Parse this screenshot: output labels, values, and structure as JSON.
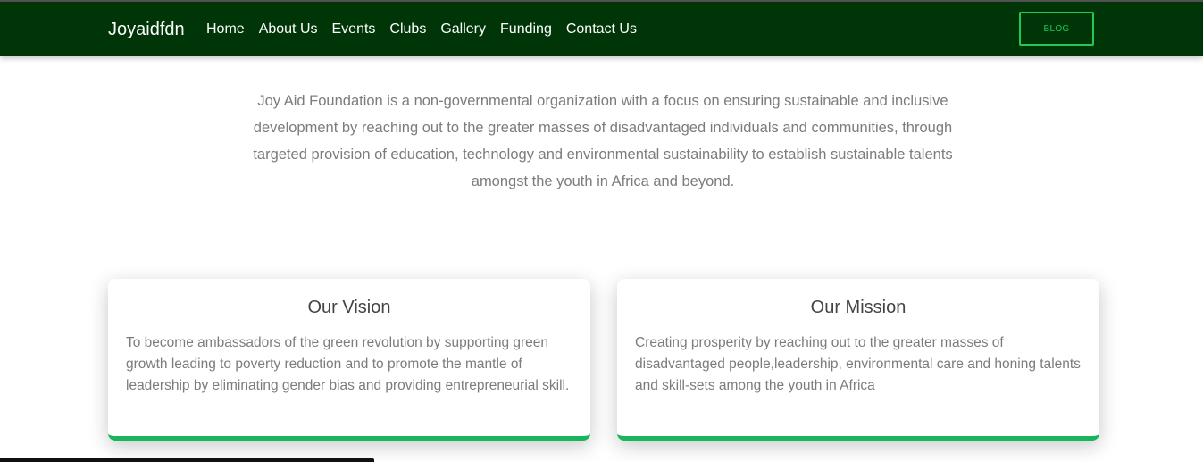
{
  "navbar": {
    "brand": "Joyaidfdn",
    "links": [
      {
        "label": "Home"
      },
      {
        "label": "About Us"
      },
      {
        "label": "Events"
      },
      {
        "label": "Clubs"
      },
      {
        "label": "Gallery"
      },
      {
        "label": "Funding"
      },
      {
        "label": "Contact Us"
      }
    ],
    "blog_label": "BLOG"
  },
  "intro": {
    "text": "Joy Aid Foundation is a non-governmental organization with a focus on ensuring sustainable and inclusive development by reaching out to the greater masses of disadvantaged individuals and communities, through targeted provision of education, technology and environmental sustainability to establish sustainable talents amongst the youth in Africa and beyond."
  },
  "cards": {
    "vision": {
      "title": "Our Vision",
      "text": "To become ambassadors of the green revolution by supporting green growth leading to poverty reduction and to promote the mantle of leadership by eliminating gender bias and providing entrepreneurial skill."
    },
    "mission": {
      "title": "Our Mission",
      "text": "Creating prosperity by reaching out to the greater masses of disadvantaged people,leadership, environmental care and honing talents and skill-sets among the youth in Africa"
    }
  },
  "colors": {
    "navbar_bg": "#003508",
    "accent_green": "#1ec95a",
    "card_border": "#19b55c",
    "body_text": "#7c7c7c",
    "heading_text": "#444444"
  }
}
